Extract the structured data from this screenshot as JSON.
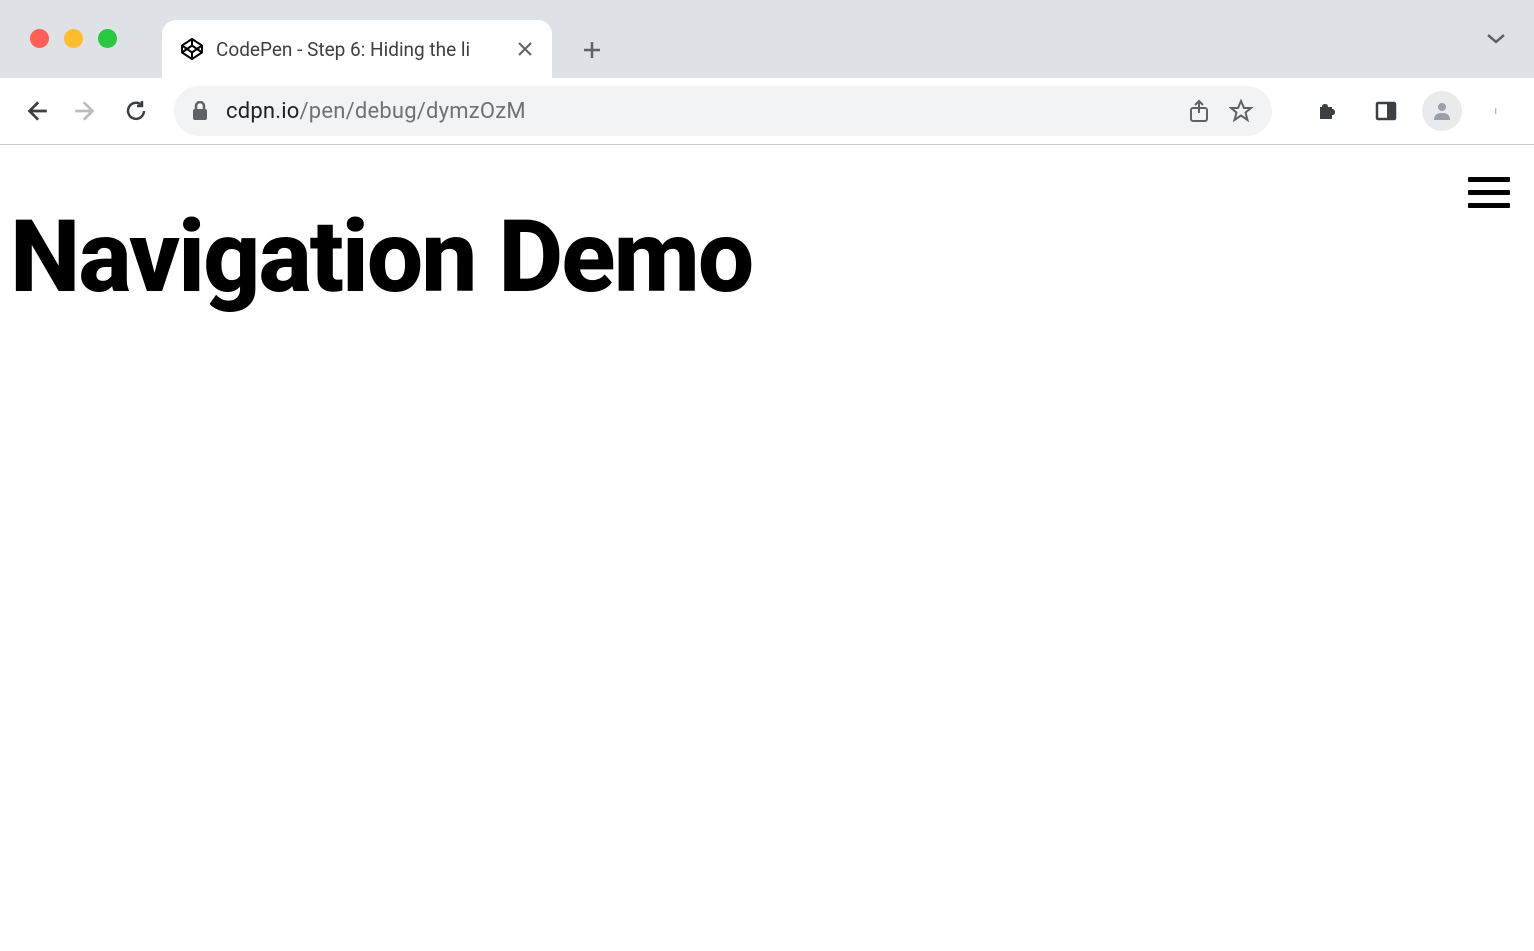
{
  "browser": {
    "tab": {
      "title": "CodePen - Step 6: Hiding the li",
      "favicon": "codepen-icon"
    },
    "url": {
      "domain": "cdpn.io",
      "path": "/pen/debug/dymzOzM"
    }
  },
  "page": {
    "heading": "Navigation Demo"
  }
}
